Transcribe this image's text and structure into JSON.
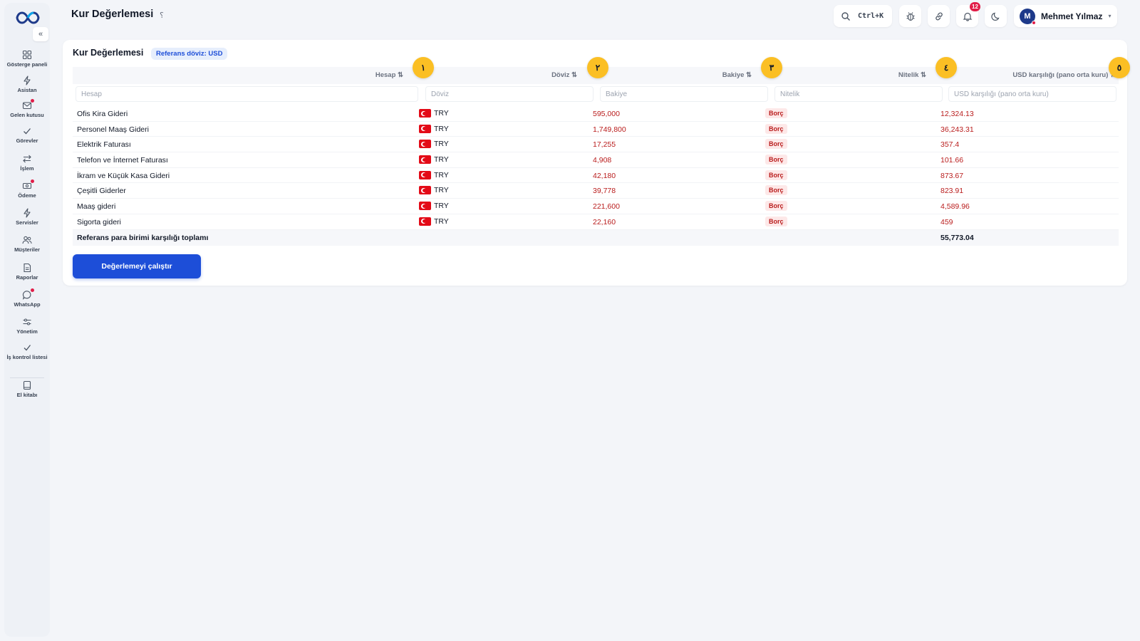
{
  "app": {
    "page_title": "Kur Değerlemesi",
    "title_icon_glyph": "؟"
  },
  "sidebar": {
    "collapse_glyph": "«",
    "items": [
      {
        "label": "Gösterge paneli",
        "icon": "dashboard-icon",
        "dot": false
      },
      {
        "label": "Asistan",
        "icon": "bolt-icon",
        "dot": false
      },
      {
        "label": "Gelen kutusu",
        "icon": "inbox-icon",
        "dot": true
      },
      {
        "label": "Görevler",
        "icon": "check-icon",
        "dot": false
      },
      {
        "label": "İşlem",
        "icon": "swap-icon",
        "dot": false
      },
      {
        "label": "Ödeme",
        "icon": "payment-icon",
        "dot": true
      },
      {
        "label": "Servisler",
        "icon": "bolt-icon",
        "dot": false
      },
      {
        "label": "Müşteriler",
        "icon": "users-icon",
        "dot": false
      },
      {
        "label": "Raporlar",
        "icon": "report-icon",
        "dot": false
      },
      {
        "label": "WhatsApp",
        "icon": "chat-icon",
        "dot": true
      },
      {
        "label": "Yönetim",
        "icon": "sliders-icon",
        "dot": false
      },
      {
        "label": "İş kontrol listesi",
        "icon": "checklist-icon",
        "dot": false
      },
      {
        "label": "El kitabı",
        "icon": "book-icon",
        "dot": false
      }
    ]
  },
  "header": {
    "search_shortcut": "Ctrl+K",
    "notification_count": "12",
    "user": {
      "initial": "M",
      "name": "Mehmet Yılmaz",
      "caret": "▾"
    }
  },
  "card": {
    "title": "Kur Değerlemesi",
    "reference_badge": "Referans döviz: USD",
    "columns": [
      {
        "label": "Hesap ⇅",
        "placeholder": "Hesap",
        "marker": "١"
      },
      {
        "label": "Döviz ⇅",
        "placeholder": "Döviz",
        "marker": "٢"
      },
      {
        "label": "Bakiye ⇅",
        "placeholder": "Bakiye",
        "marker": "٣"
      },
      {
        "label": "Nitelik ⇅",
        "placeholder": "Nitelik",
        "marker": "٤"
      },
      {
        "label": "USD karşılığı (pano orta kuru) ⇅",
        "placeholder": "USD karşılığı (pano orta kuru)",
        "marker": "٥"
      }
    ],
    "rows": [
      {
        "account": "Ofis Kira Gideri",
        "currency": "TRY",
        "balance": "595,000",
        "nature": "Borç",
        "usd": "12,324.13"
      },
      {
        "account": "Personel Maaş Gideri",
        "currency": "TRY",
        "balance": "1,749,800",
        "nature": "Borç",
        "usd": "36,243.31"
      },
      {
        "account": "Elektrik Faturası",
        "currency": "TRY",
        "balance": "17,255",
        "nature": "Borç",
        "usd": "357.4"
      },
      {
        "account": "Telefon ve İnternet Faturası",
        "currency": "TRY",
        "balance": "4,908",
        "nature": "Borç",
        "usd": "101.66"
      },
      {
        "account": "İkram ve Küçük Kasa Gideri",
        "currency": "TRY",
        "balance": "42,180",
        "nature": "Borç",
        "usd": "873.67"
      },
      {
        "account": "Çeşitli Giderler",
        "currency": "TRY",
        "balance": "39,778",
        "nature": "Borç",
        "usd": "823.91"
      },
      {
        "account": "Maaş gideri",
        "currency": "TRY",
        "balance": "221,600",
        "nature": "Borç",
        "usd": "4,589.96"
      },
      {
        "account": "Sigorta gideri",
        "currency": "TRY",
        "balance": "22,160",
        "nature": "Borç",
        "usd": "459"
      }
    ],
    "total": {
      "label": "Referans para birimi karşılığı toplamı",
      "value": "55,773.04"
    },
    "run_button": "Değerlemeyi çalıştır"
  },
  "colors": {
    "primary": "#1d4ed8",
    "debit_text": "#b91c1c",
    "marker": "#fbbf24",
    "badge": "#e11d48"
  }
}
